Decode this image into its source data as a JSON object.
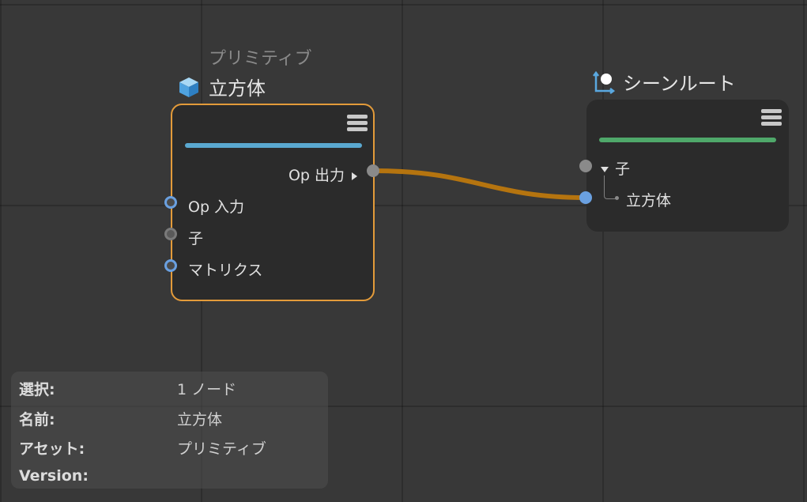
{
  "nodes": {
    "cube": {
      "subtitle": "プリミティブ",
      "title": "立方体",
      "icon": "cube-icon",
      "bar_color": "#5aa8d0",
      "ports": {
        "op_output": "Op 出力",
        "op_input": "Op 入力",
        "child": "子",
        "matrix": "マトリクス"
      }
    },
    "scene_root": {
      "title": "シーンルート",
      "icon": "scene-root-icon",
      "bar_color": "#4fa86a",
      "ports": {
        "child": "子",
        "child_item": "立方体"
      }
    }
  },
  "colors": {
    "wire": "#b5740f",
    "selection_border": "#e39b3a"
  },
  "info_panel": {
    "rows": [
      {
        "label": "選択:",
        "value": "1 ノード"
      },
      {
        "label": "名前:",
        "value": "立方体"
      },
      {
        "label": "アセット:",
        "value": "プリミティブ"
      },
      {
        "label": "Version:",
        "value": ""
      }
    ]
  }
}
